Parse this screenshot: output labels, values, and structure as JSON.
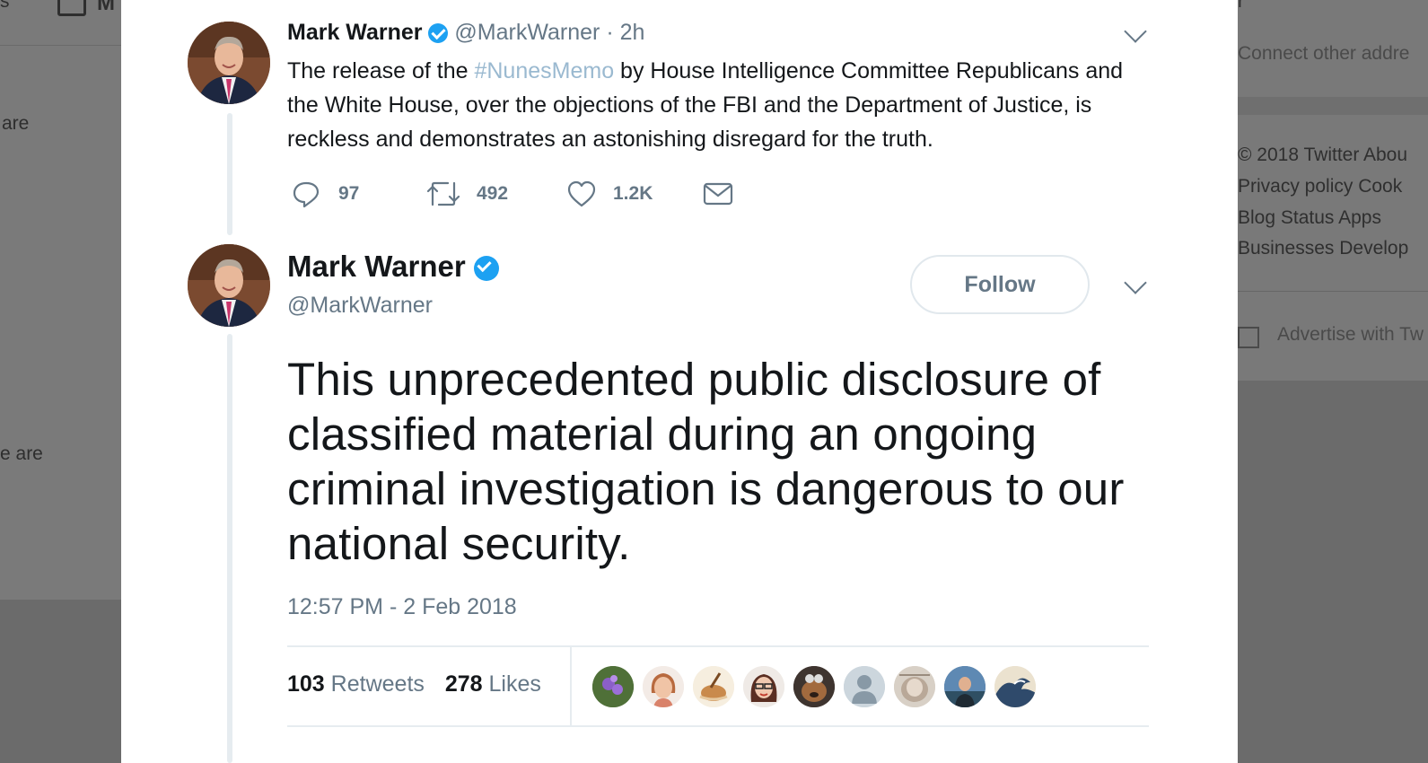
{
  "background_left": {
    "frag_top": "s",
    "frag_1": "are",
    "frag_2": "e are",
    "mail_letter": "M"
  },
  "background_right": {
    "frag_top": "r",
    "connect": "Connect other addre",
    "footer_line1": "© 2018 Twitter  Abou",
    "footer_line2": "Privacy policy  Cook",
    "footer_line3": "Blog  Status  Apps",
    "footer_line4": "Businesses  Develop",
    "advertise": "Advertise with Tw"
  },
  "tweet1": {
    "name": "Mark Warner",
    "handle": "@MarkWarner",
    "time": " · 2h",
    "text_before": "The release of the ",
    "hashtag": "#NunesMemo",
    "text_after": " by House Intelligence Committee Republicans and the White House, over the objections of the FBI and the Department of Justice, is reckless and demonstrates an astonishing disregard for the truth.",
    "replies": "97",
    "retweets": "492",
    "likes": "1.2K"
  },
  "tweet2": {
    "name": "Mark Warner",
    "handle": "@MarkWarner",
    "follow_label": "Follow",
    "text": "This unprecedented public disclosure of classified material during an ongoing criminal investigation is dangerous to our national security.",
    "timestamp": "12:57 PM - 2 Feb 2018",
    "retweet_count": "103",
    "retweet_label": "Retweets",
    "like_count": "278",
    "like_label": "Likes"
  },
  "colors": {
    "verified": "#1da1f2",
    "muted": "#657786",
    "hashtag": "#9ab9d0"
  },
  "icons": {
    "reply": "reply-icon",
    "retweet": "retweet-icon",
    "like": "heart-icon",
    "dm": "envelope-icon",
    "more": "chevron-down-icon"
  }
}
